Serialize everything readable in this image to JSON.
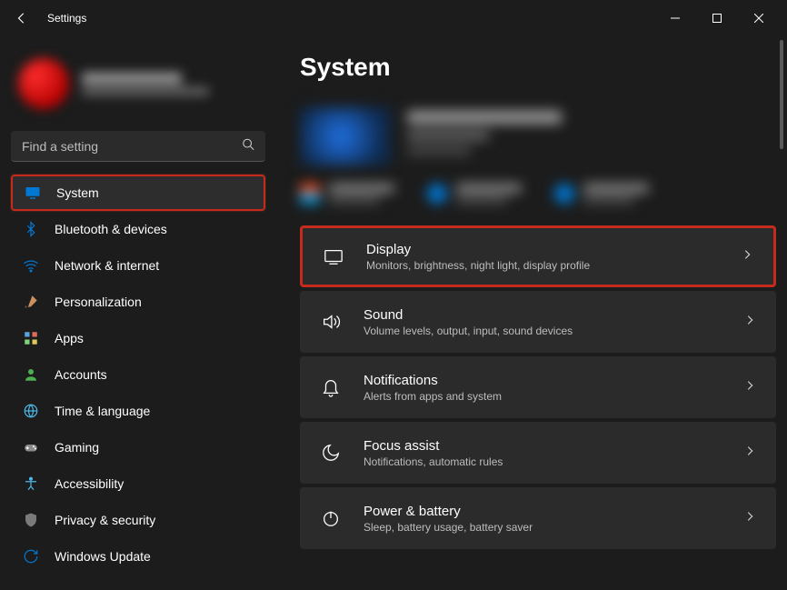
{
  "app_title": "Settings",
  "search": {
    "placeholder": "Find a setting"
  },
  "page_title": "System",
  "nav": [
    {
      "key": "system",
      "label": "System",
      "icon": "monitor",
      "active": true,
      "highlight": true
    },
    {
      "key": "bluetooth",
      "label": "Bluetooth & devices",
      "icon": "bluetooth"
    },
    {
      "key": "network",
      "label": "Network & internet",
      "icon": "wifi"
    },
    {
      "key": "personalization",
      "label": "Personalization",
      "icon": "brush"
    },
    {
      "key": "apps",
      "label": "Apps",
      "icon": "apps"
    },
    {
      "key": "accounts",
      "label": "Accounts",
      "icon": "person"
    },
    {
      "key": "time",
      "label": "Time & language",
      "icon": "globe"
    },
    {
      "key": "gaming",
      "label": "Gaming",
      "icon": "gamepad"
    },
    {
      "key": "accessibility",
      "label": "Accessibility",
      "icon": "accessibility"
    },
    {
      "key": "privacy",
      "label": "Privacy & security",
      "icon": "shield"
    },
    {
      "key": "update",
      "label": "Windows Update",
      "icon": "update"
    }
  ],
  "cards": [
    {
      "key": "display",
      "title": "Display",
      "sub": "Monitors, brightness, night light, display profile",
      "icon": "display",
      "highlight": true
    },
    {
      "key": "sound",
      "title": "Sound",
      "sub": "Volume levels, output, input, sound devices",
      "icon": "sound"
    },
    {
      "key": "notifications",
      "title": "Notifications",
      "sub": "Alerts from apps and system",
      "icon": "bell"
    },
    {
      "key": "focus",
      "title": "Focus assist",
      "sub": "Notifications, automatic rules",
      "icon": "moon"
    },
    {
      "key": "power",
      "title": "Power & battery",
      "sub": "Sleep, battery usage, battery saver",
      "icon": "power"
    }
  ]
}
